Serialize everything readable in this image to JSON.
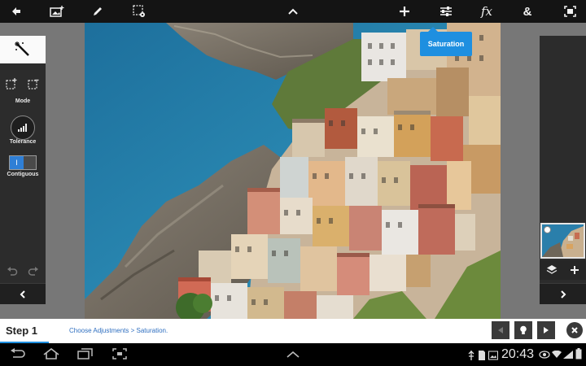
{
  "toolbar": {
    "icons": [
      "back-arrow-icon",
      "add-image-icon",
      "brush-icon",
      "selection-settings-icon",
      "collapse-chevron-icon",
      "add-icon",
      "adjustments-icon",
      "fx-icon",
      "ampersand-icon",
      "fullscreen-icon"
    ],
    "fx_label": "fx",
    "amp_label": "&"
  },
  "left_panel": {
    "mode_label": "Mode",
    "tolerance_label": "Tolerance",
    "contiguous_label": "Contiguous",
    "toggle_on_glyph": "I"
  },
  "tooltip": {
    "label": "Saturation"
  },
  "step_bar": {
    "title": "Step 1",
    "instruction": "Choose Adjustments > Saturation."
  },
  "system_bar": {
    "time": "20:43"
  },
  "colors": {
    "accent": "#1e8fe0",
    "toolbar_bg": "#141414",
    "panel_bg": "#2c2c2c",
    "workspace_bg": "#777777"
  }
}
